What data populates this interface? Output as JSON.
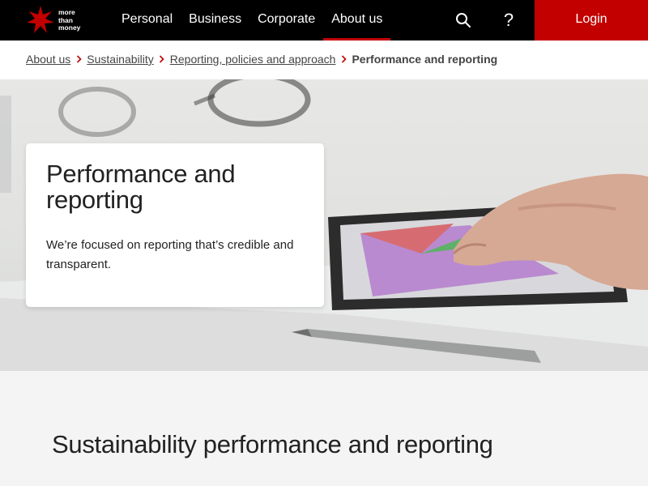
{
  "header": {
    "logo_text": "more than money",
    "logo_line1": "more",
    "logo_line2": "than",
    "logo_line3": "money",
    "nav": [
      "Personal",
      "Business",
      "Corporate",
      "About us"
    ],
    "active_nav": "About us",
    "search_icon": "search-icon",
    "help_icon": "help-icon",
    "help_glyph": "?",
    "login_label": "Login",
    "accent_color": "#c20000"
  },
  "breadcrumb": {
    "items": [
      "About us",
      "Sustainability",
      "Reporting, policies and approach"
    ],
    "current": "Performance and reporting",
    "separator_icon": "chevron-right-icon"
  },
  "hero": {
    "title": "Performance and reporting",
    "description": "We’re focused on reporting that’s credible and transparent."
  },
  "section": {
    "title": "Sustainability performance and reporting"
  }
}
